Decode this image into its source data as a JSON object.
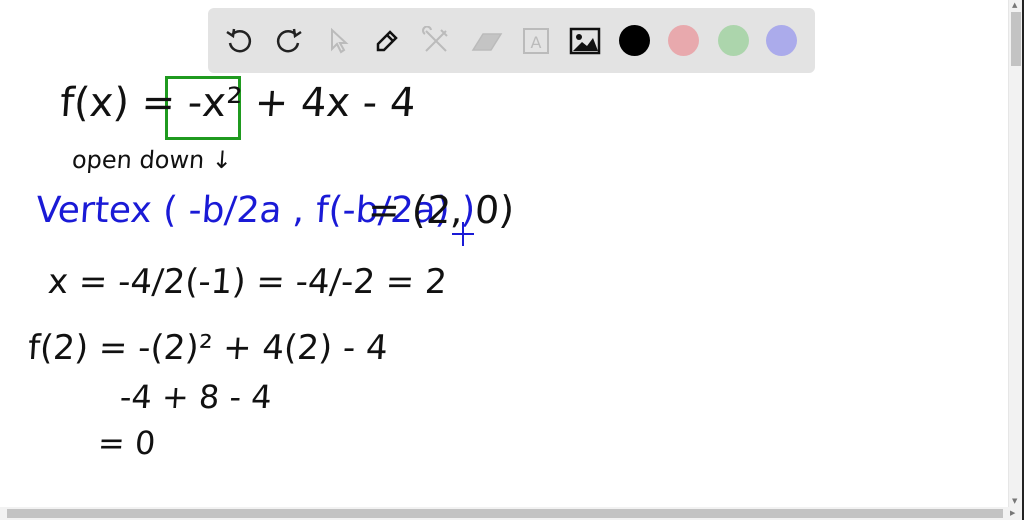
{
  "toolbar": {
    "tools": [
      "undo-icon",
      "redo-icon",
      "select-icon",
      "pen-icon",
      "tools-icon",
      "eraser-icon",
      "text-icon",
      "image-icon"
    ],
    "colors": [
      "#000000",
      "#e8a9ad",
      "#acd5ac",
      "#ababeb"
    ]
  },
  "board": {
    "line1": "f(x) = -x² + 4x - 4",
    "line2": "open down ↓",
    "line3_vertex": "Vertex ( -b/2a , f(-b/2a) )",
    "line3_result": "= (2, 0)",
    "line4": "x = -4/2(-1) = -4/-2 = 2",
    "line5": "f(2) = -(2)² + 4(2) - 4",
    "line6": "-4 + 8 - 4",
    "line7": "= 0"
  }
}
